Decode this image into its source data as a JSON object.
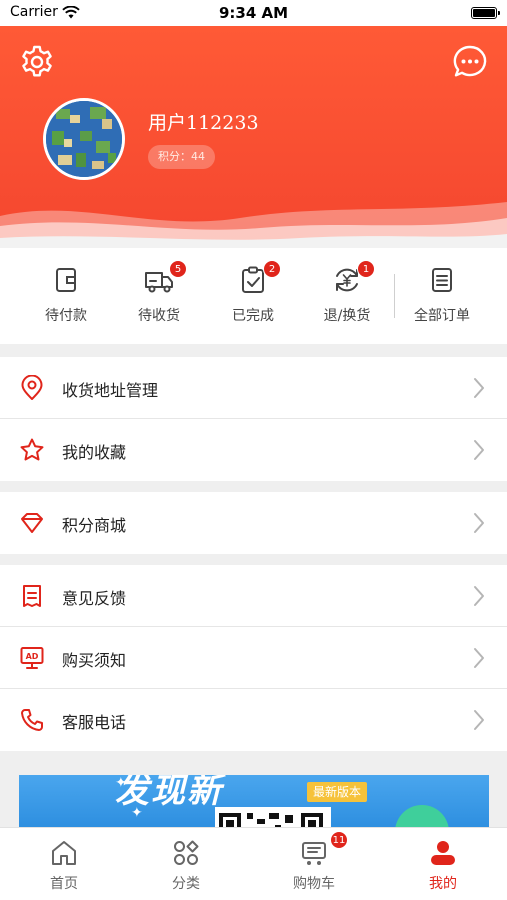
{
  "status_bar": {
    "carrier": "Carrier",
    "time": "9:34 AM"
  },
  "profile": {
    "username": "用户112233",
    "points_label": "积分：44"
  },
  "orders": [
    {
      "label": "待付款",
      "icon": "wallet-icon",
      "badge": ""
    },
    {
      "label": "待收货",
      "icon": "truck-icon",
      "badge": "5"
    },
    {
      "label": "已完成",
      "icon": "clipboard-check-icon",
      "badge": "2"
    },
    {
      "label": "退/换货",
      "icon": "refund-icon",
      "badge": "1"
    },
    {
      "label": "全部订单",
      "icon": "list-icon",
      "badge": ""
    }
  ],
  "menu": [
    {
      "label": "收货地址管理",
      "icon": "location-pin-icon"
    },
    {
      "label": "我的收藏",
      "icon": "star-icon"
    },
    {
      "label": "积分商城",
      "icon": "diamond-icon"
    },
    {
      "label": "意见反馈",
      "icon": "feedback-icon"
    },
    {
      "label": "购买须知",
      "icon": "ad-screen-icon"
    },
    {
      "label": "客服电话",
      "icon": "phone-icon"
    }
  ],
  "banner": {
    "headline": "发现新",
    "tag": "最新版本"
  },
  "tabs": [
    {
      "label": "首页",
      "icon": "home-icon",
      "badge": "",
      "active": false
    },
    {
      "label": "分类",
      "icon": "grid-icon",
      "badge": "",
      "active": false
    },
    {
      "label": "购物车",
      "icon": "cart-icon",
      "badge": "11",
      "active": false
    },
    {
      "label": "我的",
      "icon": "user-icon",
      "badge": "",
      "active": true
    }
  ],
  "colors": {
    "accent": "#e0251b",
    "header": "#f4462f",
    "banner": "#2e8fe0"
  }
}
